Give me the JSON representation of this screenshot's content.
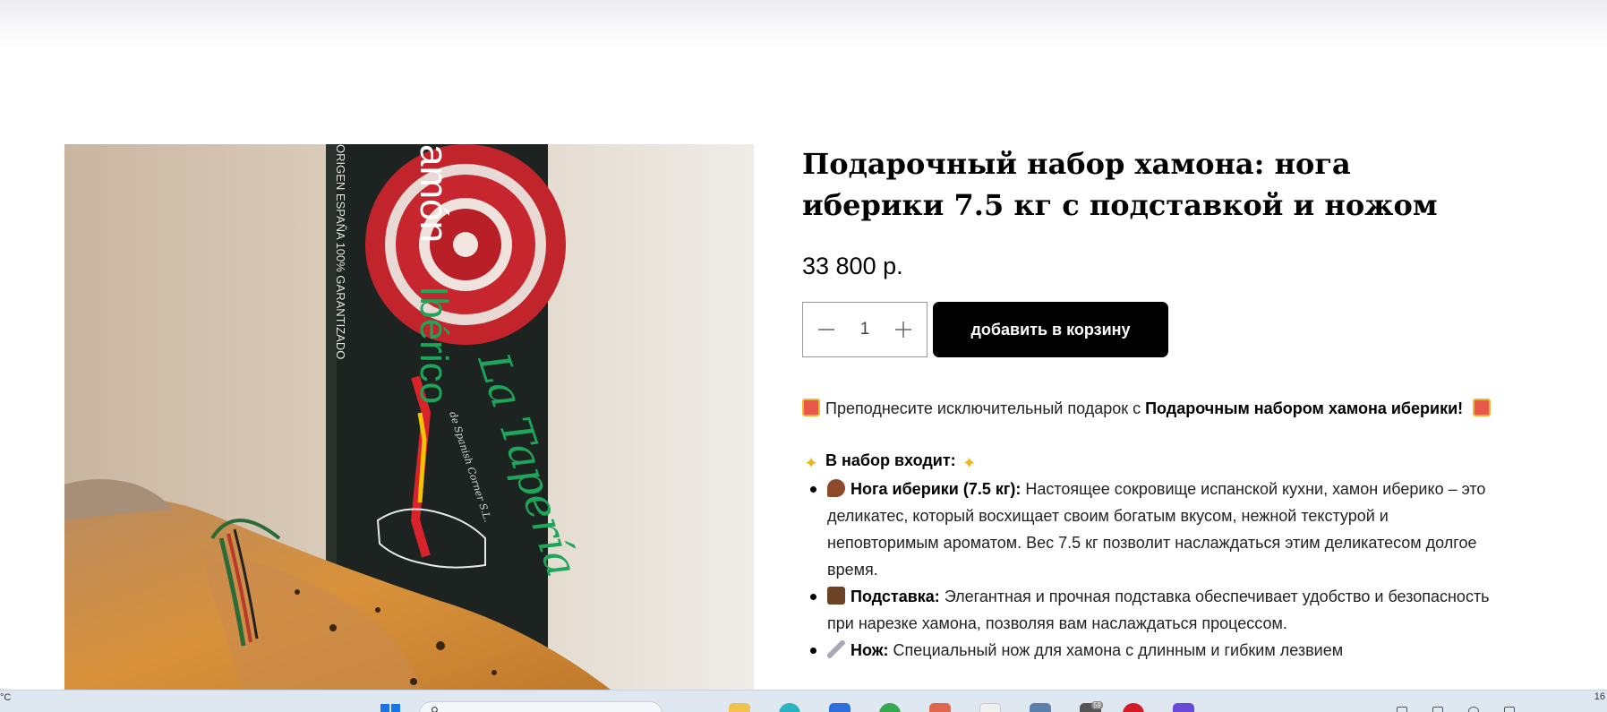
{
  "product": {
    "title": "Подарочный набор хамона: нога иберики 7.5 кг с подставкой и ножом",
    "price": "33 800 р.",
    "quantity": "1",
    "add_to_cart_label": "добавить в корзину"
  },
  "photo": {
    "box_text_1": "amón",
    "box_text_2": "Ibérico",
    "box_text_3": "ORIGEN ESPAÑA 100% GARANTIZADO",
    "box_brand": "La Tapería",
    "box_tagline": "de Spanish Corner S.L."
  },
  "description": {
    "intro_plain": "Преподнесите исключительный подарок с ",
    "intro_bold": "Подарочным набором хамона иберики!",
    "set_heading": "В набор входит:",
    "items": [
      {
        "name": "Нога иберики (7.5 кг):",
        "text": " Настоящее сокровище испанской кухни, хамон иберико – это деликатес, который восхищает своим богатым вкусом, нежной текстурой и неповторимым ароматом. Вес 7.5 кг позволит наслаждаться этим деликатесом долгое время."
      },
      {
        "name": "Подставка:",
        "text": " Элегантная и прочная подставка обеспечивает удобство и безопасность при нарезке хамона, позволяя вам наслаждаться процессом."
      },
      {
        "name": "Нож:",
        "text": " Специальный нож для хамона с длинным и гибким лезвием"
      }
    ]
  },
  "taskbar": {
    "temperature": "°C",
    "clock": "16",
    "badge": "59"
  },
  "colors": {
    "button_bg": "#000000",
    "button_text": "#ffffff",
    "taskbar_bg": "#dfe7f1",
    "box_green": "#1fa55a",
    "box_red": "#d8232a"
  },
  "icons": [
    "minus-icon",
    "plus-icon",
    "gift-icon",
    "sparkles-icon",
    "ham-leg-icon",
    "stand-icon",
    "knife-icon",
    "windows-start-icon",
    "search-icon"
  ]
}
